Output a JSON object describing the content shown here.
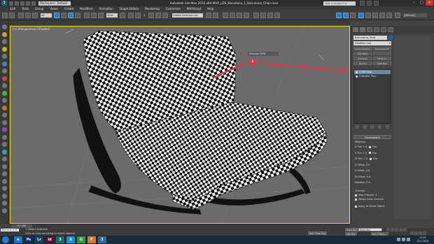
{
  "titlebar": {
    "workspace": "Workspace: Default",
    "title": "Autodesk 3ds Max 2016 x64      MAX_LDS_Barcelona_1_Barcelona_Chair.max",
    "search_placeholder": "Type a keyword or phrase"
  },
  "menu": [
    "Edit",
    "Tools",
    "Group",
    "Views",
    "Create",
    "Modifiers",
    "Animation",
    "Graph Editors",
    "Rendering",
    "Customize",
    "MAXScript",
    "Help"
  ],
  "toolbar": {
    "filter": "All",
    "view": "View",
    "snaps": "3",
    "selection_set": "Create Selection Se",
    "layer": "[Default]"
  },
  "viewport": {
    "label": "[+] [Perspective] [Shaded]",
    "annotation_label": "Unwrap UVW",
    "callout_number": "1"
  },
  "command_panel": {
    "object_name": "Barcelona_Seat",
    "modifier_list": "Modifier List",
    "button_rows": [
      [
        "Quad Chamfer",
        "TurboSmooth"
      ],
      [
        "Edit Mesh",
        ""
      ],
      [
        "Edit Poly",
        "FFD(box)"
      ],
      [
        "Normal",
        "UVW Map"
      ]
    ],
    "stack": [
      {
        "label": "UVW Map",
        "selected": true
      },
      {
        "label": "Editable Poly",
        "selected": false
      }
    ],
    "rollout_title": "Parameters",
    "mapping_label": "Mapping:",
    "params": [
      {
        "label": "U Tile: 1.0",
        "flip": "Flip"
      },
      {
        "label": "V Tile: 1.0",
        "flip": "Flip"
      },
      {
        "label": "W Tile: 1.0",
        "flip": "Flip"
      },
      {
        "label": "U Offset: 0.0",
        "flip": ""
      },
      {
        "label": "V Offset: 0.0",
        "flip": ""
      },
      {
        "label": "W Offset: 0.0",
        "flip": ""
      },
      {
        "label": "Rotation: 0.0",
        "flip": ""
      }
    ],
    "channel_label": "Channel:",
    "map_channel": "Map Channel: 1",
    "vertex_color": "Vertex Color Channel",
    "apply_label": "Apply to Entire Object"
  },
  "timeline": {
    "frame": "0 / 100"
  },
  "status": {
    "welcome": "Welcome to M",
    "selected": "1 Object Selected",
    "hint": "Click or click-and-drag to select objects",
    "add_time_tag": "Add Time Tag",
    "auto_key": "Auto Key",
    "selected_dd": "Selected",
    "set_key": "Set Key",
    "key_filters": "Key Filters..."
  },
  "taskbar": {
    "apps": [
      {
        "label": "e",
        "color": "#1e73c8"
      },
      {
        "label": "Ps",
        "color": "#0d2f5a"
      },
      {
        "label": "Lr",
        "color": "#1a3f5a"
      },
      {
        "label": "Id",
        "color": "#5a0d2f"
      },
      {
        "label": "3",
        "color": "#1a6a6a"
      },
      {
        "label": "S",
        "color": "#1a8fd6"
      },
      {
        "label": "G",
        "color": "#2f9a3a"
      },
      {
        "label": "F",
        "color": "#d6772f"
      },
      {
        "label": "3",
        "color": "#2f6a9a"
      }
    ],
    "time": "11:00",
    "date": "25.1.2016"
  },
  "colors": {
    "accent": "#2e7fbf",
    "annotation": "#e2334a",
    "viewport_border": "#f0e000"
  }
}
